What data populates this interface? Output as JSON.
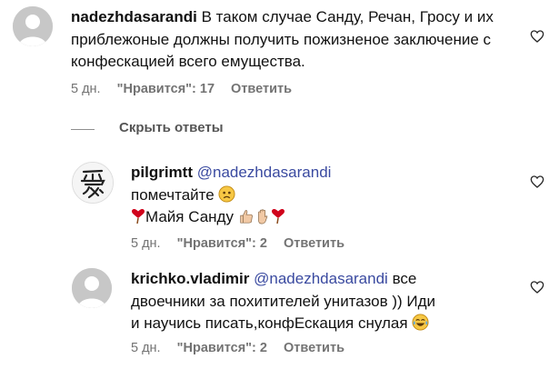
{
  "comments": [
    {
      "username": "nadezhdasarandi",
      "text": "В таком случае Санду, Речан, Гросу и их приблежоные должны получить пожизненое заключение с конфескацией всего емущества.",
      "time": "5 дн.",
      "likes": "\"Нравится\": 17",
      "reply": "Ответить"
    }
  ],
  "hide_replies": "Скрыть ответы",
  "replies": [
    {
      "username": "pilgrimtt",
      "mention": "@nadezhdasarandi",
      "line1": "помечтайте",
      "line2": "Майя Санду",
      "time": "5 дн.",
      "likes": "\"Нравится\": 2",
      "reply": "Ответить"
    },
    {
      "username": "krichko.vladimir",
      "mention": "@nadezhdasarandi",
      "text_part1": "все двоечники за похитителей унитазов )) Иди и научись писать,конфЕскация снулая",
      "time": "5 дн.",
      "likes": "\"Нравится\": 2",
      "reply": "Ответить"
    }
  ],
  "colors": {
    "mention": "#3a4aa0",
    "meta": "#737373",
    "heart_red": "#d0021b"
  },
  "icons": [
    "heart-outline-icon",
    "default-avatar-icon",
    "kanji-avatar",
    "sad-face-emoji",
    "red-heart-emoji",
    "thumbs-up-emoji",
    "raised-hand-emoji",
    "tears-of-joy-emoji"
  ]
}
